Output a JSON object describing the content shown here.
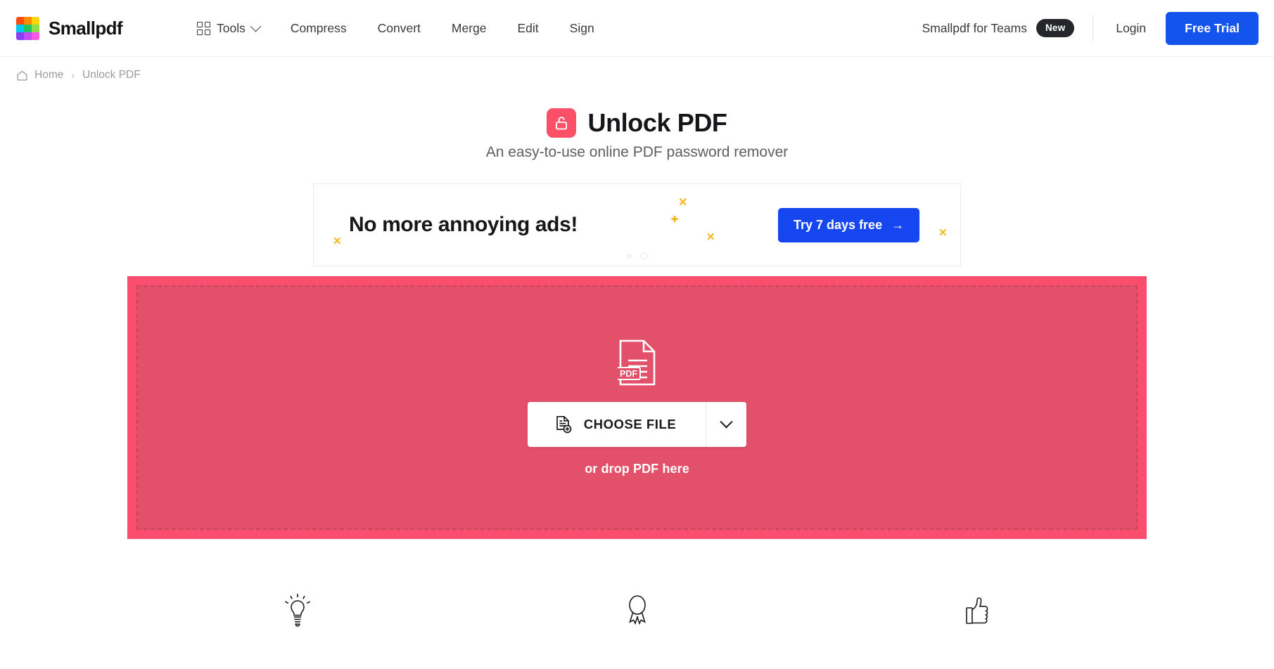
{
  "header": {
    "brand": {
      "name": "Smallpdf",
      "logo_icon": "smallpdf-logo-grid",
      "logo_colors": [
        "#fc4a10",
        "#fb8c00",
        "#ffd400",
        "#00c8f0",
        "#22c55e",
        "#8ede4a",
        "#8b3ff5",
        "#c34cf6",
        "#f857e8"
      ]
    },
    "nav": [
      {
        "label": "Tools",
        "icon": "grid-icon",
        "has_chevron": true
      },
      {
        "label": "Compress",
        "icon": null,
        "has_chevron": false
      },
      {
        "label": "Convert",
        "icon": null,
        "has_chevron": false
      },
      {
        "label": "Merge",
        "icon": null,
        "has_chevron": false
      },
      {
        "label": "Edit",
        "icon": null,
        "has_chevron": false
      },
      {
        "label": "Sign",
        "icon": null,
        "has_chevron": false
      }
    ],
    "teams": {
      "label": "Smallpdf for Teams",
      "badge": "New"
    },
    "login_label": "Login",
    "trial_label": "Free Trial",
    "accent_blue": "#1354ed"
  },
  "breadcrumb": {
    "home_icon": "home-icon",
    "home_label": "Home",
    "separator": "›",
    "current_label": "Unlock PDF"
  },
  "hero": {
    "icon": "unlock-padlock-icon",
    "icon_color": "#fb5068",
    "title": "Unlock PDF",
    "subtitle": "An easy-to-use online PDF password remover"
  },
  "ad": {
    "headline": "No more annoying ads!",
    "cta_label": "Try 7 days free",
    "cta_arrow": "→",
    "cta_color": "#1546f0",
    "spark_color": "#f5b820",
    "sparks": [
      "✕",
      "✚",
      "✕",
      "✕",
      "✕"
    ],
    "carousel_dots": 2
  },
  "dropzone": {
    "file_icon": "pdf-file-icon",
    "file_icon_label": "PDF",
    "choose_icon": "document-add-icon",
    "choose_label": "CHOOSE FILE",
    "dropdown_icon": "chevron-down-icon",
    "hint": "or drop PDF here",
    "outer_color": "#fb4e6e",
    "inner_color": "#e2506a",
    "dash_color": "#c9455c"
  },
  "features": [
    {
      "icon": "lightbulb-icon"
    },
    {
      "icon": "award-ribbon-icon"
    },
    {
      "icon": "thumbs-up-icon"
    }
  ]
}
